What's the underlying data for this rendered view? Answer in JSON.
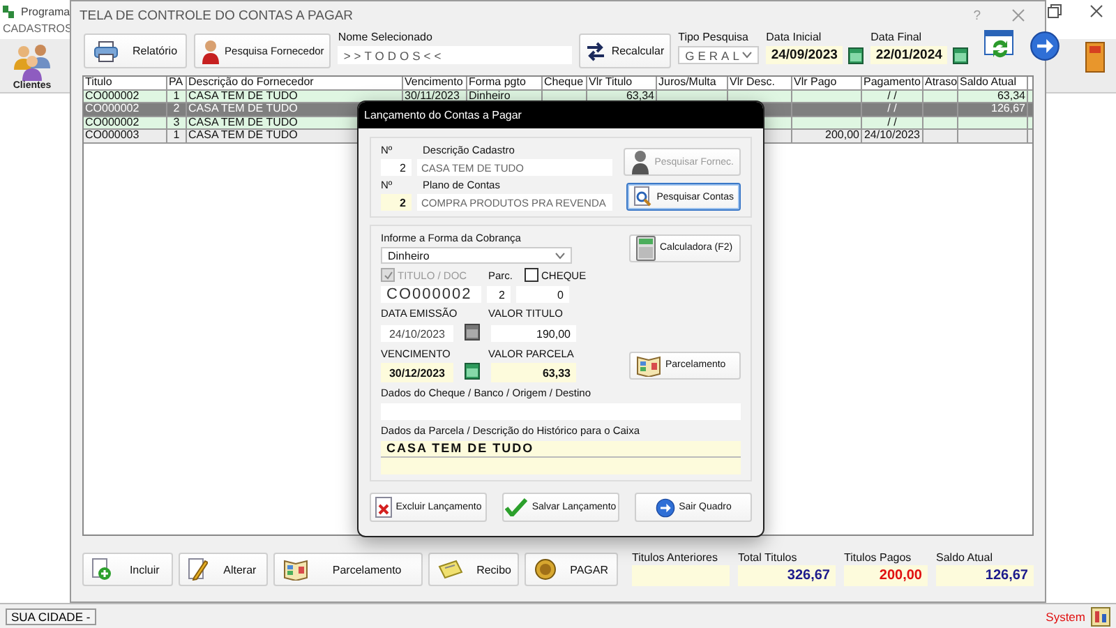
{
  "app": {
    "title": "Programa",
    "menu": [
      "CADASTROS"
    ],
    "toolbar": [
      {
        "label": "Clientes"
      }
    ],
    "status_bar": {
      "left": "SUA CIDADE -",
      "right": "System"
    }
  },
  "window": {
    "title": "TELA DE CONTROLE DO CONTAS A PAGAR",
    "help": "?"
  },
  "toolbar": {
    "report_button": "Relatório",
    "supplier_button": "Pesquisa Fornecedor",
    "selected_name": {
      "label": "Nome Selecionado",
      "value": ">>TODOS<<"
    },
    "recalc_button": "Recalcular",
    "search_type": {
      "label": "Tipo Pesquisa",
      "value": "GERAL"
    },
    "start_date": {
      "label": "Data Inicial",
      "value": "24/09/2023"
    },
    "end_date": {
      "label": "Data Final",
      "value": "22/01/2024"
    }
  },
  "table": {
    "columns": [
      "Titulo",
      "PA",
      "Descrição do Fornecedor",
      "Vencimento",
      "Forma pgto",
      "Cheque",
      "Vlr Titulo",
      "Juros/Multa",
      "Vlr Desc.",
      "Vlr Pago",
      "Pagamento",
      "Atraso",
      "Saldo Atual"
    ],
    "rows": [
      {
        "titulo": "CO000002",
        "pa": "1",
        "fornecedor": "CASA TEM DE TUDO",
        "vencimento": "30/11/2023",
        "forma_pgto": "Dinheiro",
        "vlr_titulo": "63,34",
        "pagamento": "/ /",
        "saldo_atual": "63,34",
        "selected": false,
        "paid": false
      },
      {
        "titulo": "CO000002",
        "pa": "2",
        "fornecedor": "CASA TEM DE TUDO",
        "pagamento": "/ /",
        "saldo_atual": "126,67",
        "selected": true,
        "paid": false
      },
      {
        "titulo": "CO000002",
        "pa": "3",
        "fornecedor": "CASA TEM DE TUDO",
        "pagamento": "/ /",
        "selected": false,
        "paid": false
      },
      {
        "titulo": "CO000003",
        "pa": "1",
        "fornecedor": "CASA TEM DE TUDO",
        "vlr_pago": "200,00",
        "pagamento": "24/10/2023",
        "selected": false,
        "paid": true
      }
    ]
  },
  "dialog": {
    "title": "Lançamento do Contas a Pagar",
    "supplier": {
      "number_label": "Nº",
      "label": "Descrição Cadastro",
      "number": "2",
      "value": "CASA TEM DE TUDO",
      "button": {
        "label": "Pesquisar Fornec.",
        "disabled": true,
        "focused": false
      }
    },
    "account": {
      "number_label": "Nº",
      "label": "Plano de Contas",
      "number": "2",
      "value": "COMPRA PRODUTOS PRA REVENDA",
      "button": {
        "label": "Pesquisar Contas",
        "disabled": false,
        "focused": true
      }
    },
    "payment_form": {
      "label": "Informe a Forma da Cobrança",
      "value": "Dinheiro"
    },
    "calculator_button": "Calculadora (F2)",
    "title_doc": {
      "label": "TITULO / DOC",
      "checked": true,
      "disabled": true,
      "value": "CO000002"
    },
    "installment": {
      "label": "Parc.",
      "value": "2"
    },
    "cheque": {
      "label": "CHEQUE",
      "checked": false,
      "value": "0"
    },
    "issue_date": {
      "label": "DATA EMISSÃO",
      "value": "24/10/2023"
    },
    "title_value": {
      "label": "VALOR TITULO",
      "value": "190,00"
    },
    "due_date": {
      "label": "VENCIMENTO",
      "value": "30/12/2023"
    },
    "installment_value": {
      "label": "VALOR PARCELA",
      "value": "63,33"
    },
    "installments_button": "Parcelamento",
    "cheque_data": {
      "label": "Dados do Cheque / Banco / Origem / Destino"
    },
    "history": {
      "label": "Dados da Parcela / Descrição do Histórico para o Caixa",
      "value": "CASA TEM DE TUDO"
    },
    "buttons": [
      {
        "kind": "delete",
        "label": "Excluir Lançamento"
      },
      {
        "kind": "save",
        "label": "Salvar Lançamento"
      },
      {
        "kind": "exit",
        "label": "Sair Quadro"
      }
    ]
  },
  "actions": [
    {
      "kind": "add",
      "label": "Incluir"
    },
    {
      "kind": "edit",
      "label": "Alterar"
    },
    {
      "kind": "installments",
      "label": "Parcelamento"
    },
    {
      "kind": "receipt",
      "label": "Recibo"
    },
    {
      "kind": "pay",
      "label": "PAGAR"
    }
  ],
  "totals": [
    {
      "label": "Titulos Anteriores"
    },
    {
      "label": "Total Titulos",
      "value": "326,67",
      "color": "#1c1a8c"
    },
    {
      "label": "Titulos Pagos",
      "value": "200,00",
      "color": "#e01010"
    },
    {
      "label": "Saldo Atual",
      "value": "126,67",
      "color": "#1c1a8c"
    }
  ]
}
